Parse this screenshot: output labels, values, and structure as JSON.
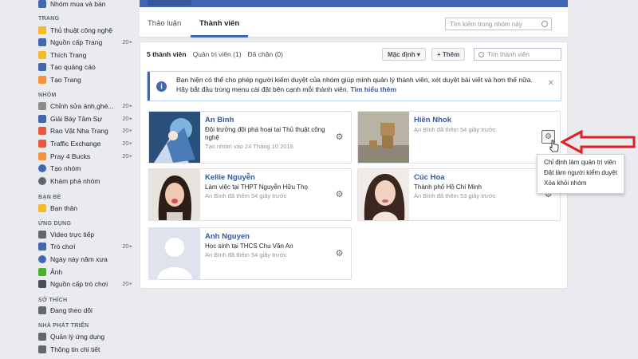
{
  "sidebar": {
    "top_item": "Nhóm mua và bán",
    "sections": [
      {
        "title": "TRANG",
        "items": [
          {
            "label": "Thủ thuật công nghệ",
            "count": "",
            "color": "#f7b928"
          },
          {
            "label": "Nguồn cấp Trang",
            "count": "20+",
            "color": "#4267b2"
          },
          {
            "label": "Thích Trang",
            "count": "",
            "color": "#f7b928"
          },
          {
            "label": "Tạo quảng cáo",
            "count": "",
            "color": "#4267b2"
          },
          {
            "label": "Tạo Trang",
            "count": "",
            "color": "#f7923a"
          }
        ]
      },
      {
        "title": "NHÓM",
        "items": [
          {
            "label": "Chỉnh sửa ảnh,ghé...",
            "count": "20+",
            "color": "#8b8b8b"
          },
          {
            "label": "Giải Bày Tâm Sự",
            "count": "20+",
            "color": "#4267b2"
          },
          {
            "label": "Rao Vặt Nha Trang",
            "count": "20+",
            "color": "#e9573f"
          },
          {
            "label": "Traffic Exchange",
            "count": "20+",
            "color": "#e9573f"
          },
          {
            "label": "Pray 4 Bucks",
            "count": "20+",
            "color": "#f7923a"
          },
          {
            "label": "Tạo nhóm",
            "count": "",
            "color": "#4267b2"
          },
          {
            "label": "Khám phá nhóm",
            "count": "",
            "color": "#606770"
          }
        ]
      },
      {
        "title": "BẠN BÈ",
        "items": [
          {
            "label": "Bạn thân",
            "count": "",
            "color": "#f7b928"
          }
        ]
      },
      {
        "title": "ỨNG DỤNG",
        "items": [
          {
            "label": "Video trực tiếp",
            "count": "",
            "color": "#606770"
          },
          {
            "label": "Trò chơi",
            "count": "20+",
            "color": "#4267b2"
          },
          {
            "label": "Ngày này năm xưa",
            "count": "",
            "color": "#4267b2"
          },
          {
            "label": "Ảnh",
            "count": "",
            "color": "#42b72a"
          },
          {
            "label": "Nguồn cấp trò chơi",
            "count": "20+",
            "color": "#4b4f56"
          }
        ]
      },
      {
        "title": "SỞ THÍCH",
        "items": [
          {
            "label": "Đang theo dõi",
            "count": "",
            "color": "#606770"
          }
        ]
      },
      {
        "title": "NHÀ PHÁT TRIỂN",
        "items": [
          {
            "label": "Quản lý ứng dụng",
            "count": "",
            "color": "#606770"
          },
          {
            "label": "Thông tin chi tiết",
            "count": "",
            "color": "#606770"
          }
        ]
      }
    ]
  },
  "group_tabs": {
    "tabs": [
      "Thảo luận",
      "Thành viên"
    ],
    "active": "Thành viên",
    "search_placeholder": "Tìm kiếm trong nhóm này"
  },
  "members_panel": {
    "sub_tabs": [
      "5 thành viên",
      "Quản trị viên (1)",
      "Đã chặn (0)"
    ],
    "sort_button": "Mặc định ▾",
    "add_button": "+ Thêm",
    "search_placeholder": "Tìm thành viên"
  },
  "notice": {
    "text": "Bạn hiện có thể cho phép người kiểm duyệt của nhóm giúp mình quản lý thành viên, xét duyệt bài viết và hơn thế nữa. Hãy bắt đầu trong menu cài đặt bên cạnh mỗi thành viên.",
    "link": "Tìm hiểu thêm",
    "close": "✕"
  },
  "members": [
    {
      "name": "An Bình",
      "desc": "Đội trưởng đội phá hoại tại Thủ thuật công nghệ",
      "meta": "Tạo nhóm vào 24 Tháng 10 2016"
    },
    {
      "name": "Hiền Nhok",
      "desc": "",
      "meta": "An Bình đã thêm 54 giây trước"
    },
    {
      "name": "Kellie Nguyễn",
      "desc": "Làm việc tại THPT Nguyễn Hữu Thọ",
      "meta": "An Bình đã thêm 54 giây trước"
    },
    {
      "name": "Cúc Hoa",
      "desc": "Thành phố Hồ Chí Minh",
      "meta": "An Bình đã thêm 53 giây trước"
    },
    {
      "name": "Anh Nguyen",
      "desc": "Học sinh tại THCS Chu Văn An",
      "meta": "An Bình đã thêm 54 giây trước"
    }
  ],
  "dropdown": {
    "items": [
      "Chỉ định làm quản trị viên",
      "Đặt làm người kiểm duyệt",
      "Xóa khỏi nhóm"
    ]
  },
  "colors": {
    "brand": "#4267b2",
    "link": "#365899",
    "annotation_arrow": "#e02020"
  }
}
